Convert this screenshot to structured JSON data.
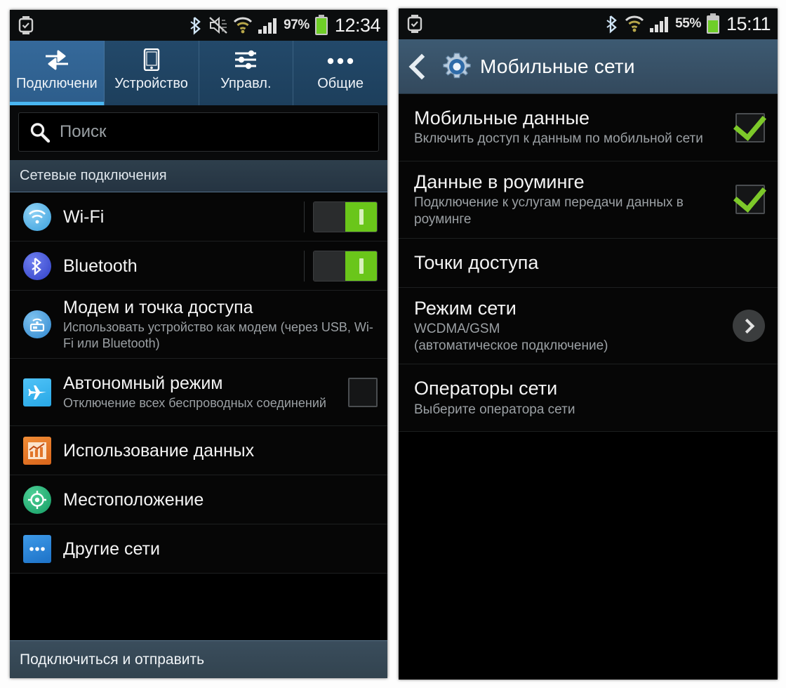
{
  "left_phone": {
    "statusbar": {
      "icons": [
        "watch-icon",
        "bluetooth-icon",
        "mute-icon",
        "wifi-icon",
        "signal-icon"
      ],
      "battery_percent": "97%",
      "clock": "12:34"
    },
    "tabs": [
      {
        "label": "Подключени",
        "icon": "connections-arrows-icon",
        "active": true
      },
      {
        "label": "Устройство",
        "icon": "phone-icon",
        "active": false
      },
      {
        "label": "Управл.",
        "icon": "sliders-icon",
        "active": false
      },
      {
        "label": "Общие",
        "icon": "more-dots-icon",
        "active": false
      }
    ],
    "search": {
      "placeholder": "Поиск",
      "value": "",
      "icon": "search-icon"
    },
    "section_header": "Сетевые подключения",
    "rows": [
      {
        "title": "Wi-Fi",
        "subtitle": "",
        "icon": "wifi-round-icon",
        "control": "toggle",
        "toggle_on": true
      },
      {
        "title": "Bluetooth",
        "subtitle": "",
        "icon": "bluetooth-round-icon",
        "control": "toggle",
        "toggle_on": true
      },
      {
        "title": "Модем и точка доступа",
        "subtitle": "Использовать устройство как модем (через USB, Wi-Fi или Bluetooth)",
        "icon": "hotspot-icon",
        "control": "none",
        "toggle_on": false
      },
      {
        "title": "Автономный режим",
        "subtitle": "Отключение всех беспроводных соединений",
        "icon": "airplane-icon",
        "control": "checkbox",
        "checked": false
      },
      {
        "title": "Использование данных",
        "subtitle": "",
        "icon": "data-usage-chart-icon",
        "control": "none"
      },
      {
        "title": "Местоположение",
        "subtitle": "",
        "icon": "location-icon",
        "control": "none"
      },
      {
        "title": "Другие сети",
        "subtitle": "",
        "icon": "more-networks-icon",
        "control": "none"
      }
    ],
    "bottom_bar": "Подключиться и отправить"
  },
  "right_phone": {
    "statusbar": {
      "icons": [
        "watch-icon",
        "bluetooth-icon",
        "wifi-icon",
        "signal-icon"
      ],
      "battery_percent": "55%",
      "clock": "15:11"
    },
    "header": {
      "back_icon": "back-chevron-icon",
      "app_icon": "settings-gear-icon",
      "title": "Мобильные сети"
    },
    "rows": [
      {
        "title": "Мобильные данные",
        "subtitle": "Включить доступ к данным по мобильной сети",
        "control": "checkbox",
        "checked": true
      },
      {
        "title": "Данные в роуминге",
        "subtitle": "Подключение к услугам передачи данных в роуминге",
        "control": "checkbox",
        "checked": true
      },
      {
        "title": "Точки доступа",
        "subtitle": "",
        "control": "none"
      },
      {
        "title": "Режим сети",
        "subtitle": "WCDMA/GSM\n(автоматическое подключение)",
        "control": "chevron"
      },
      {
        "title": "Операторы сети",
        "subtitle": "Выберите оператора сети",
        "control": "none"
      }
    ]
  },
  "colors": {
    "accent_blue": "#49b6f2",
    "header_blue": "#3d5a72",
    "tab_active": "#35699a",
    "toggle_green": "#6ac61a",
    "check_green": "#7dc92a",
    "background": "#000000"
  }
}
